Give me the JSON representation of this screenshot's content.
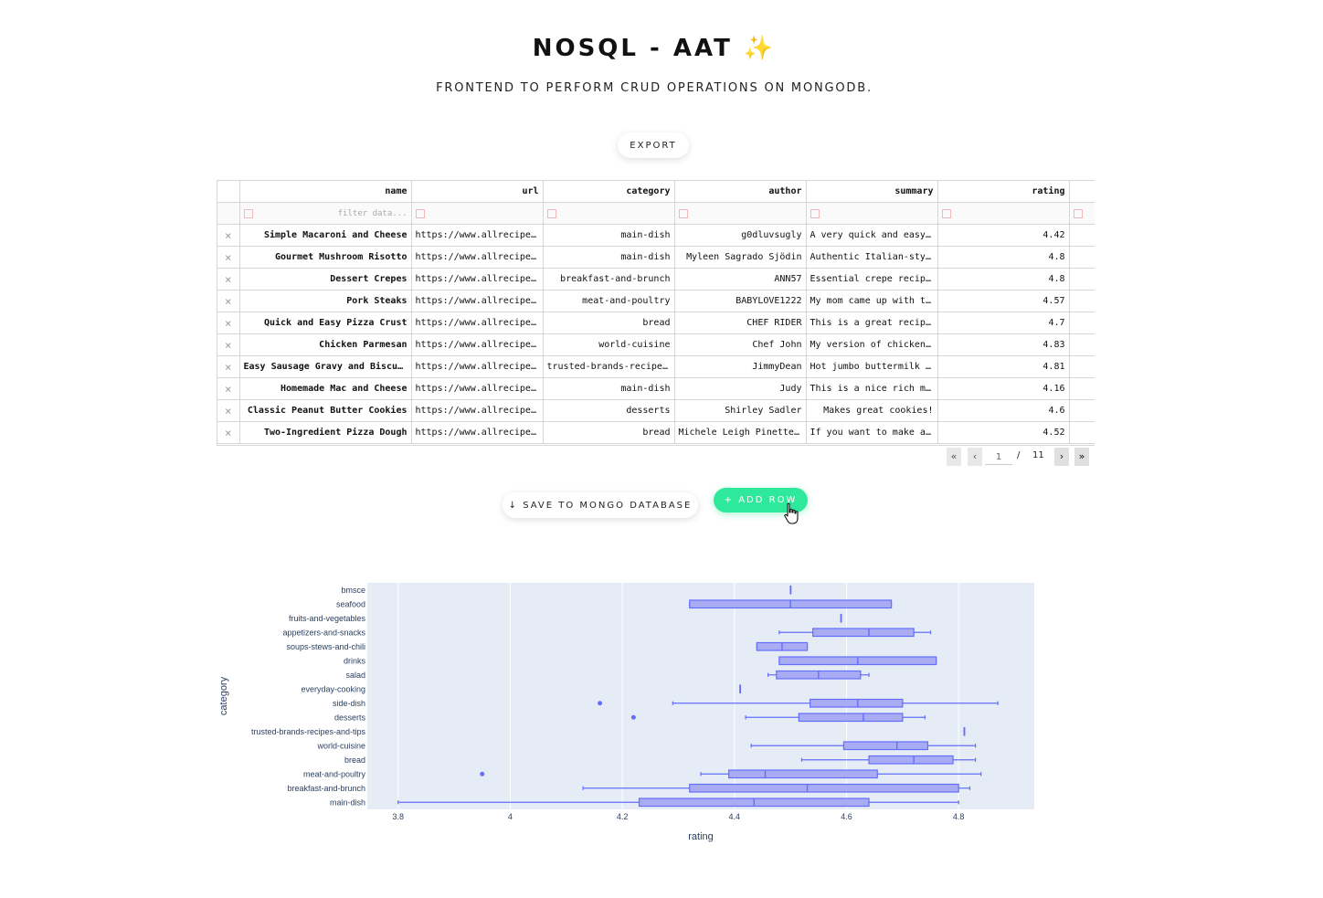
{
  "header": {
    "title": "NOSQL - AAT",
    "title_emoji": "✨",
    "subtitle": "FRONTEND TO PERFORM CRUD OPERATIONS ON MONGODB."
  },
  "buttons": {
    "export": "EXPORT",
    "save": "↓ SAVE TO MONGO DATABASE",
    "add_row": "+ ADD ROW"
  },
  "table": {
    "columns": [
      "name",
      "url",
      "category",
      "author",
      "summary",
      "rating"
    ],
    "filter_placeholder": "filter data...",
    "delete_glyph": "×",
    "rows": [
      {
        "name": "Simple Macaroni and Cheese",
        "url": "https://www.allrecipes…",
        "category": "main-dish",
        "author": "g0dluvsugly",
        "summary": "A very quick and easy …",
        "rating": "4.42"
      },
      {
        "name": "Gourmet Mushroom Risotto",
        "url": "https://www.allrecipes…",
        "category": "main-dish",
        "author": "Myleen Sagrado Sjödin",
        "summary": "Authentic Italian-styl…",
        "rating": "4.8"
      },
      {
        "name": "Dessert Crepes",
        "url": "https://www.allrecipes…",
        "category": "breakfast-and-brunch",
        "author": "ANN57",
        "summary": "Essential crepe recipe…",
        "rating": "4.8"
      },
      {
        "name": "Pork Steaks",
        "url": "https://www.allrecipes…",
        "category": "meat-and-poultry",
        "author": "BABYLOVE1222",
        "summary": "My mom came up with th…",
        "rating": "4.57"
      },
      {
        "name": "Quick and Easy Pizza Crust",
        "url": "https://www.allrecipes…",
        "category": "bread",
        "author": "CHEF RIDER",
        "summary": "This is a great recipe…",
        "rating": "4.7"
      },
      {
        "name": "Chicken Parmesan",
        "url": "https://www.allrecipes…",
        "category": "world-cuisine",
        "author": "Chef John",
        "summary": "My version of chicken …",
        "rating": "4.83"
      },
      {
        "name": "Easy Sausage Gravy and Biscuits",
        "url": "https://www.allrecipes…",
        "category": "trusted-brands-recipes…",
        "author": "JimmyDean",
        "summary": "Hot jumbo buttermilk b…",
        "rating": "4.81"
      },
      {
        "name": "Homemade Mac and Cheese",
        "url": "https://www.allrecipes…",
        "category": "main-dish",
        "author": "Judy",
        "summary": "This is a nice rich ma…",
        "rating": "4.16"
      },
      {
        "name": "Classic Peanut Butter Cookies",
        "url": "https://www.allrecipes…",
        "category": "desserts",
        "author": "Shirley Sadler",
        "summary": "Makes great cookies!",
        "rating": "4.6"
      },
      {
        "name": "Two-Ingredient Pizza Dough",
        "url": "https://www.allrecipes…",
        "category": "bread",
        "author": "Michele Leigh Pinette …",
        "summary": "If you want to make a …",
        "rating": "4.52"
      }
    ]
  },
  "pagination": {
    "first": "«",
    "prev": "‹",
    "next": "›",
    "last": "»",
    "current_page": "1",
    "separator": "/",
    "total_pages": "11"
  },
  "chart_data": {
    "type": "box",
    "orientation": "horizontal",
    "xlabel": "rating",
    "ylabel": "category",
    "xlim": [
      3.745,
      4.935
    ],
    "xticks": [
      3.8,
      4,
      4.2,
      4.4,
      4.6,
      4.8
    ],
    "xtick_labels": [
      "3.8",
      "4",
      "4.2",
      "4.4",
      "4.6",
      "4.8"
    ],
    "grid": true,
    "colors": {
      "box_fill": "#a9acf3",
      "box_line": "#636efa",
      "plot_bg": "#e5ecf6",
      "axis_text": "#2a3f5f"
    },
    "series": [
      {
        "category": "bmsce",
        "min": 4.5,
        "q1": 4.5,
        "median": 4.5,
        "q3": 4.5,
        "max": 4.5,
        "outliers": []
      },
      {
        "category": "seafood",
        "min": 4.32,
        "q1": 4.32,
        "median": 4.5,
        "q3": 4.68,
        "max": 4.68,
        "outliers": []
      },
      {
        "category": "fruits-and-vegetables",
        "min": 4.59,
        "q1": 4.59,
        "median": 4.59,
        "q3": 4.59,
        "max": 4.59,
        "outliers": []
      },
      {
        "category": "appetizers-and-snacks",
        "min": 4.48,
        "q1": 4.54,
        "median": 4.64,
        "q3": 4.72,
        "max": 4.75,
        "outliers": []
      },
      {
        "category": "soups-stews-and-chili",
        "min": 4.44,
        "q1": 4.44,
        "median": 4.485,
        "q3": 4.53,
        "max": 4.53,
        "outliers": []
      },
      {
        "category": "drinks",
        "min": 4.48,
        "q1": 4.48,
        "median": 4.62,
        "q3": 4.76,
        "max": 4.76,
        "outliers": []
      },
      {
        "category": "salad",
        "min": 4.46,
        "q1": 4.475,
        "median": 4.55,
        "q3": 4.625,
        "max": 4.64,
        "outliers": []
      },
      {
        "category": "everyday-cooking",
        "min": 4.41,
        "q1": 4.41,
        "median": 4.41,
        "q3": 4.41,
        "max": 4.41,
        "outliers": []
      },
      {
        "category": "side-dish",
        "min": 4.29,
        "q1": 4.535,
        "median": 4.62,
        "q3": 4.7,
        "max": 4.87,
        "outliers": [
          4.16
        ]
      },
      {
        "category": "desserts",
        "min": 4.42,
        "q1": 4.515,
        "median": 4.63,
        "q3": 4.7,
        "max": 4.74,
        "outliers": [
          4.22
        ]
      },
      {
        "category": "trusted-brands-recipes-and-tips",
        "min": 4.81,
        "q1": 4.81,
        "median": 4.81,
        "q3": 4.81,
        "max": 4.81,
        "outliers": []
      },
      {
        "category": "world-cuisine",
        "min": 4.43,
        "q1": 4.595,
        "median": 4.69,
        "q3": 4.745,
        "max": 4.83,
        "outliers": []
      },
      {
        "category": "bread",
        "min": 4.52,
        "q1": 4.64,
        "median": 4.72,
        "q3": 4.79,
        "max": 4.83,
        "outliers": []
      },
      {
        "category": "meat-and-poultry",
        "min": 4.34,
        "q1": 4.39,
        "median": 4.455,
        "q3": 4.655,
        "max": 4.84,
        "outliers": [
          3.95
        ]
      },
      {
        "category": "breakfast-and-brunch",
        "min": 4.13,
        "q1": 4.32,
        "median": 4.53,
        "q3": 4.8,
        "max": 4.82,
        "outliers": []
      },
      {
        "category": "main-dish",
        "min": 3.8,
        "q1": 4.23,
        "median": 4.435,
        "q3": 4.64,
        "max": 4.8,
        "outliers": []
      }
    ]
  }
}
